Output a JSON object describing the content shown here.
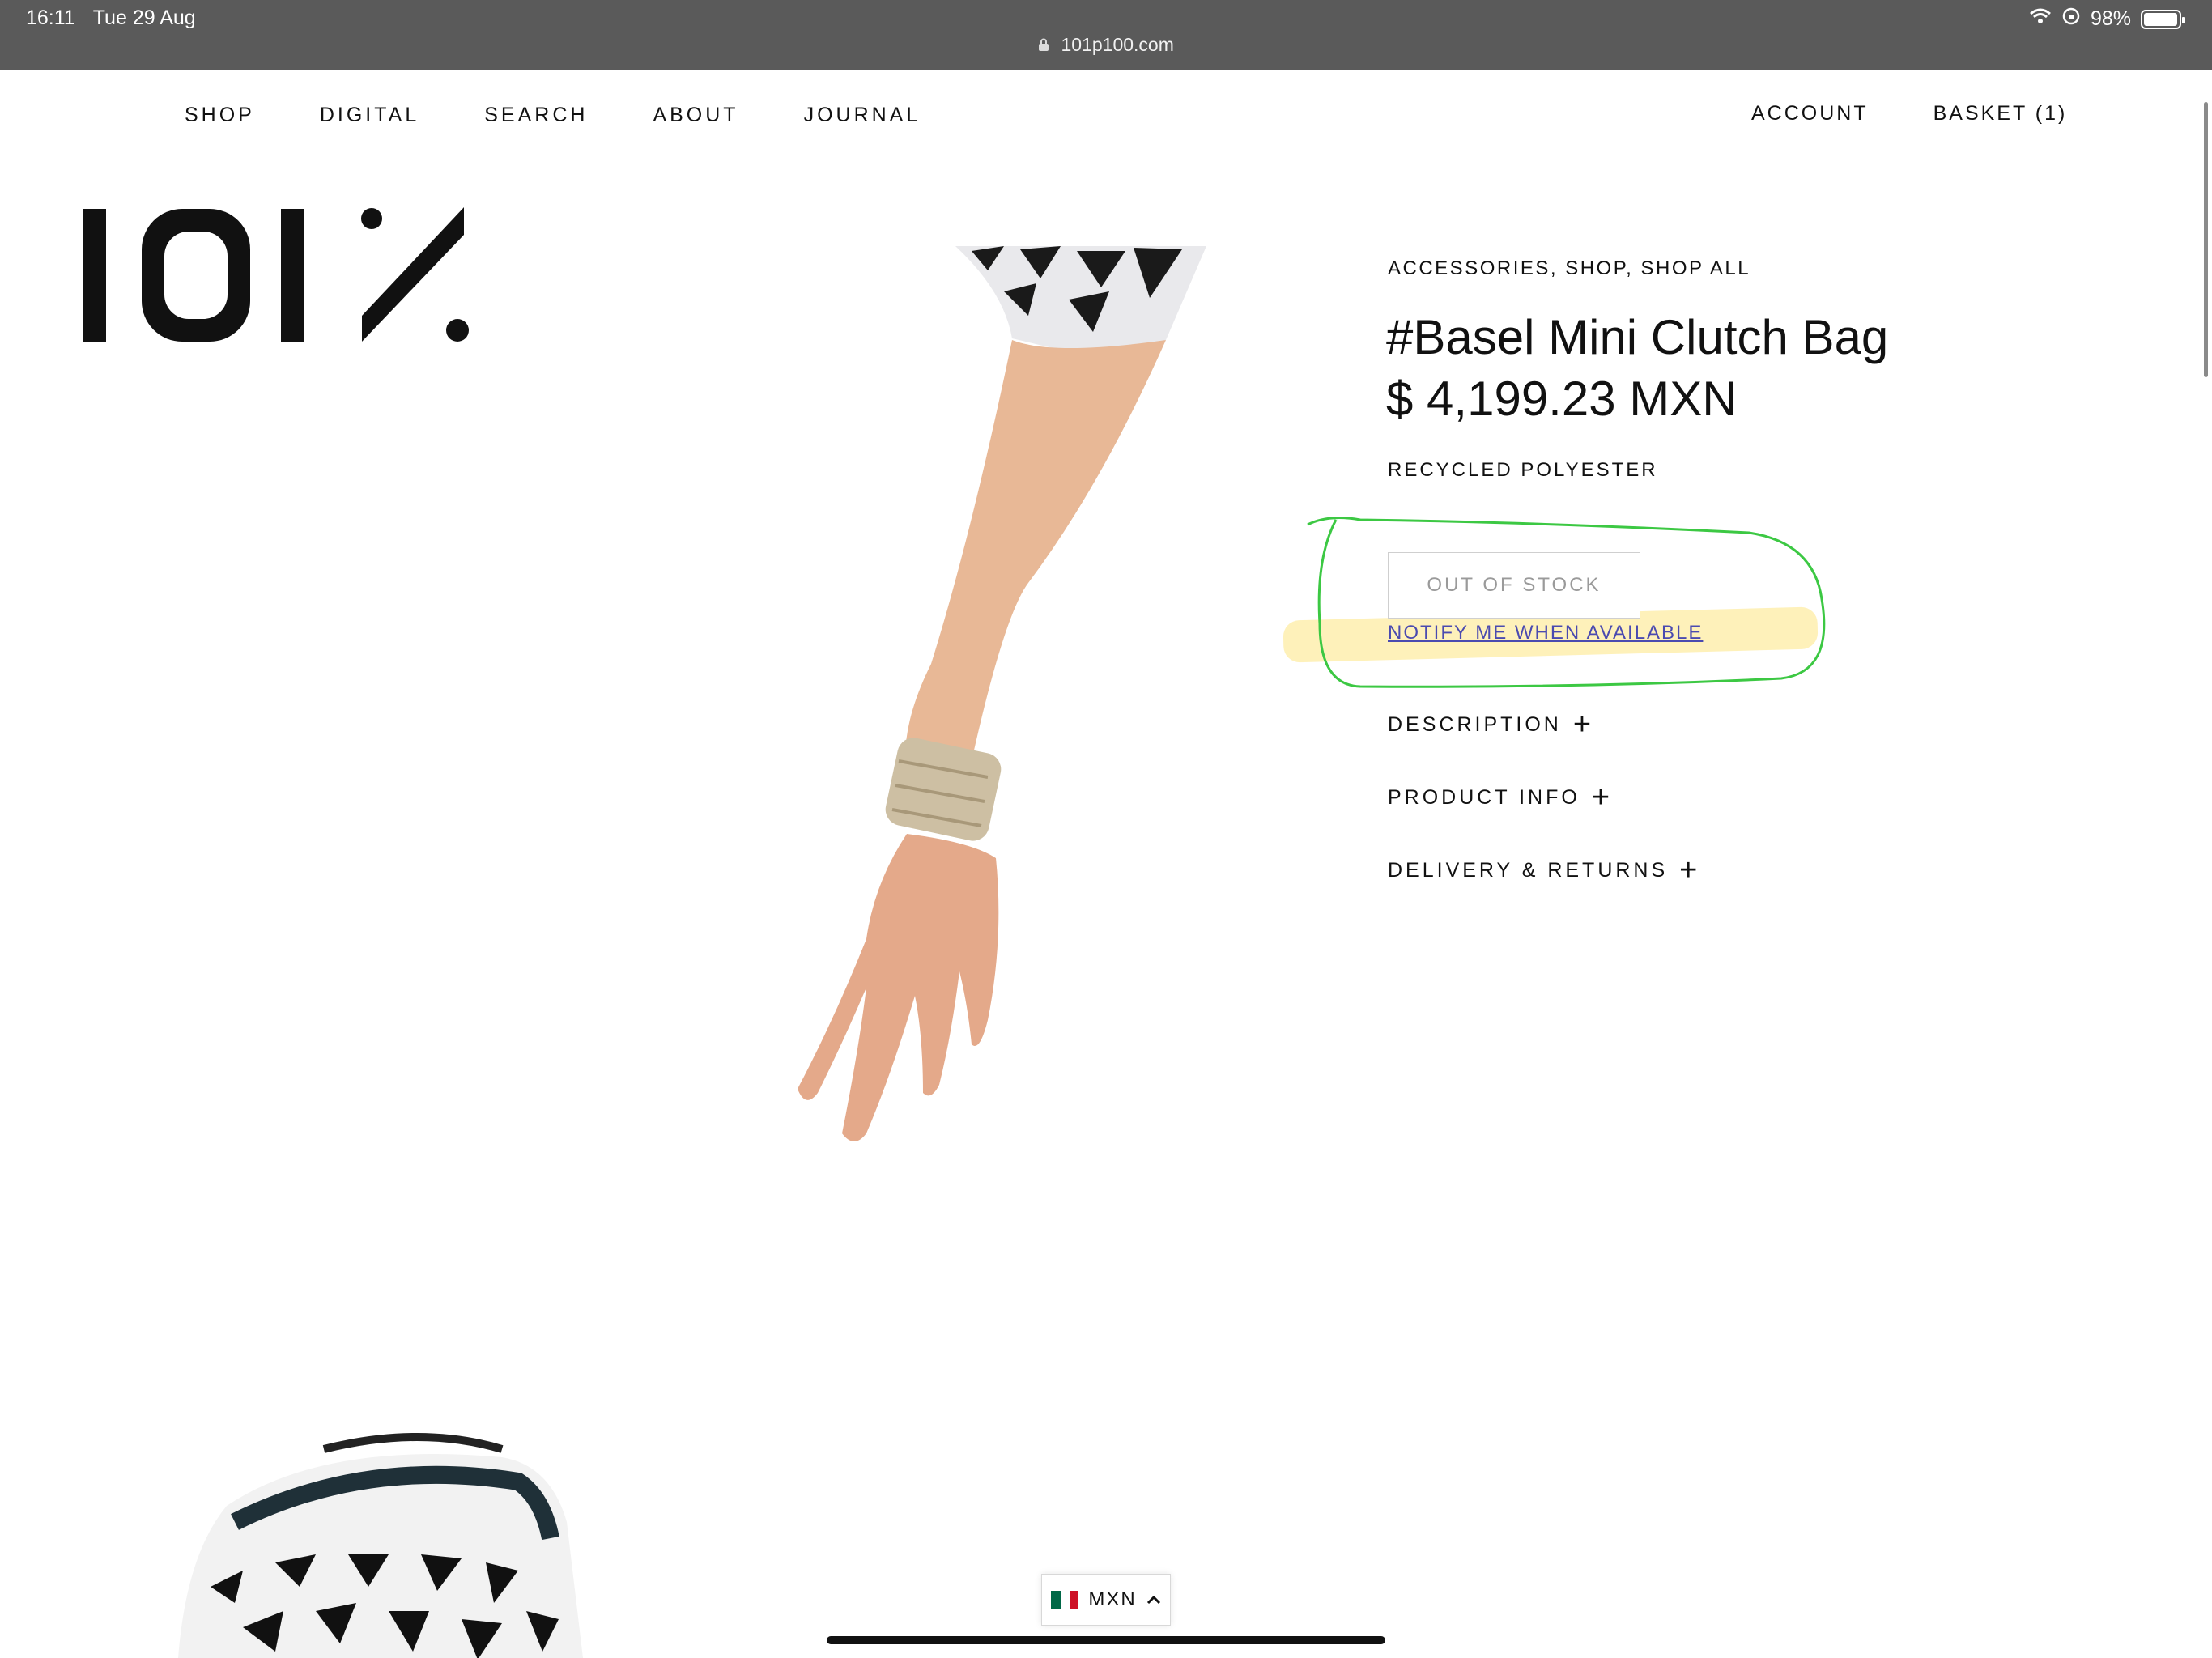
{
  "status_bar": {
    "time": "16:11",
    "date": "Tue 29 Aug",
    "url": "101p100.com",
    "battery": "98%",
    "battery_level": 0.98
  },
  "nav": {
    "left": [
      "SHOP",
      "DIGITAL",
      "SEARCH",
      "ABOUT",
      "JOURNAL"
    ],
    "account": "ACCOUNT",
    "basket": "BASKET (1)"
  },
  "product": {
    "breadcrumb": "ACCESSORIES, SHOP, SHOP ALL",
    "title": "#Basel Mini Clutch Bag",
    "price": "$ 4,199.23 MXN",
    "material": "RECYCLED POLYESTER",
    "stock_button": "OUT OF STOCK",
    "notify_link": "NOTIFY ME WHEN AVAILABLE",
    "accordions": [
      {
        "label": "DESCRIPTION"
      },
      {
        "label": "PRODUCT INFO"
      },
      {
        "label": "DELIVERY & RETURNS"
      }
    ]
  },
  "currency": {
    "code": "MXN"
  },
  "colors": {
    "status_bar": "#5a5a5a",
    "annotation_green": "#2ecc40",
    "highlight_yellow": "#fde682",
    "link": "#4a4ab0"
  }
}
